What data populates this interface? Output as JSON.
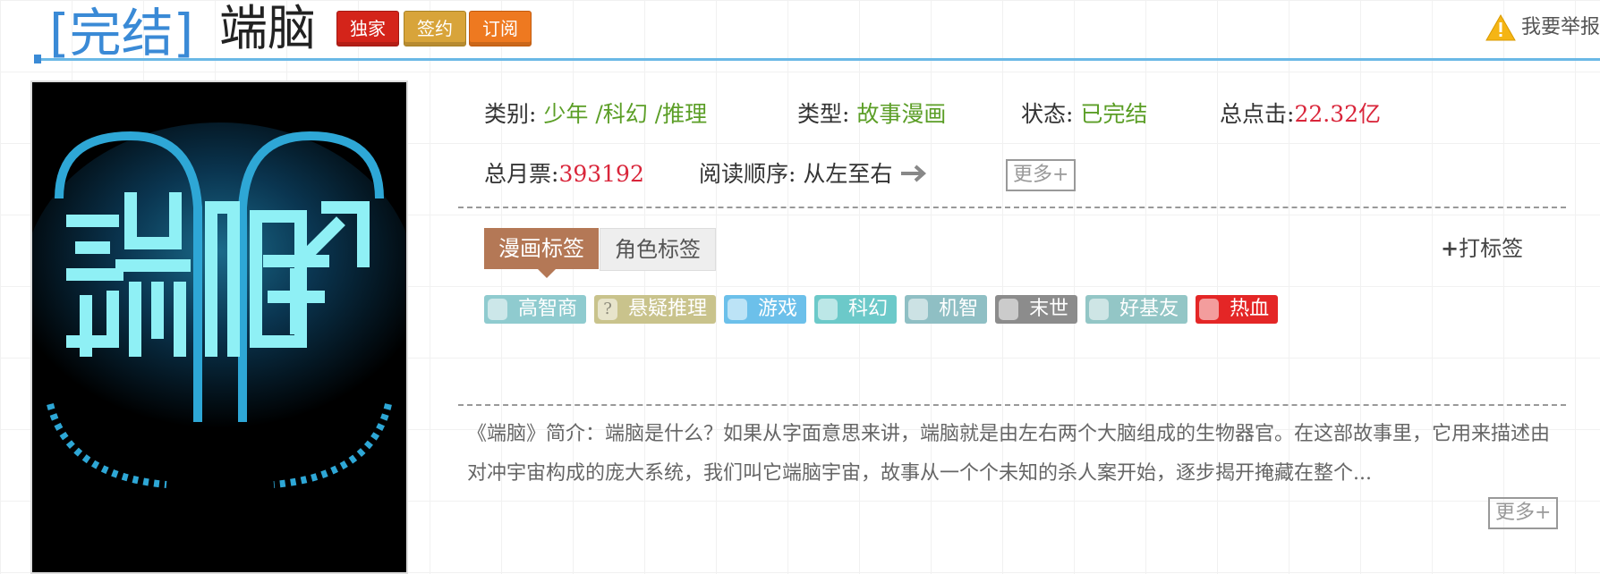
{
  "header": {
    "status_label": "[完结]",
    "title": "端脑",
    "badges": [
      "独家",
      "签约",
      "订阅"
    ],
    "report_label": "我要举报"
  },
  "cover": {
    "alt": "端脑"
  },
  "info": {
    "category_label": "类别:",
    "category_value": "少年 /科幻 /推理",
    "type_label": "类型:",
    "type_value": "故事漫画",
    "status_label": "状态:",
    "status_value": "已完结",
    "clicks_label": "总点击:",
    "clicks_value": "22.32亿",
    "monthly_label": "总月票:",
    "monthly_value": "393192",
    "order_label": "阅读顺序:",
    "order_value": "从左至右",
    "more_label": "更多+"
  },
  "tabs": {
    "comic_tags": "漫画标签",
    "character_tags": "角色标签",
    "add_tag": "打标签"
  },
  "tags": [
    {
      "label": "高智商",
      "color": "#8fcbcf",
      "icon": "brain-icon"
    },
    {
      "label": "悬疑推理",
      "color": "#c9c38c",
      "icon": "question-icon"
    },
    {
      "label": "游戏",
      "color": "#6cc0ea",
      "icon": "gamepad-icon"
    },
    {
      "label": "科幻",
      "color": "#6cc9c9",
      "icon": "atom-icon"
    },
    {
      "label": "机智",
      "color": "#8fbfc4",
      "icon": "head-icon"
    },
    {
      "label": "末世",
      "color": "#8c8c8c",
      "icon": "explosion-icon"
    },
    {
      "label": "好基友",
      "color": "#93c6c6",
      "icon": "friends-icon"
    },
    {
      "label": "热血",
      "color": "#e42626",
      "icon": "blood-drop-icon"
    }
  ],
  "description": {
    "text": "《端脑》简介：端脑是什么？如果从字面意思来讲，端脑就是由左右两个大脑组成的生物器官。在这部故事里，它用来描述由对冲宇宙构成的庞大系统，我们叫它端脑宇宙，故事从一个个未知的杀人案开始，逐步揭开掩藏在整个...",
    "more_label": "更多+"
  },
  "colors": {
    "accent_blue": "#3a8ad6",
    "green": "#5b9e26",
    "red": "#d9253a",
    "tab_active": "#b47856"
  }
}
